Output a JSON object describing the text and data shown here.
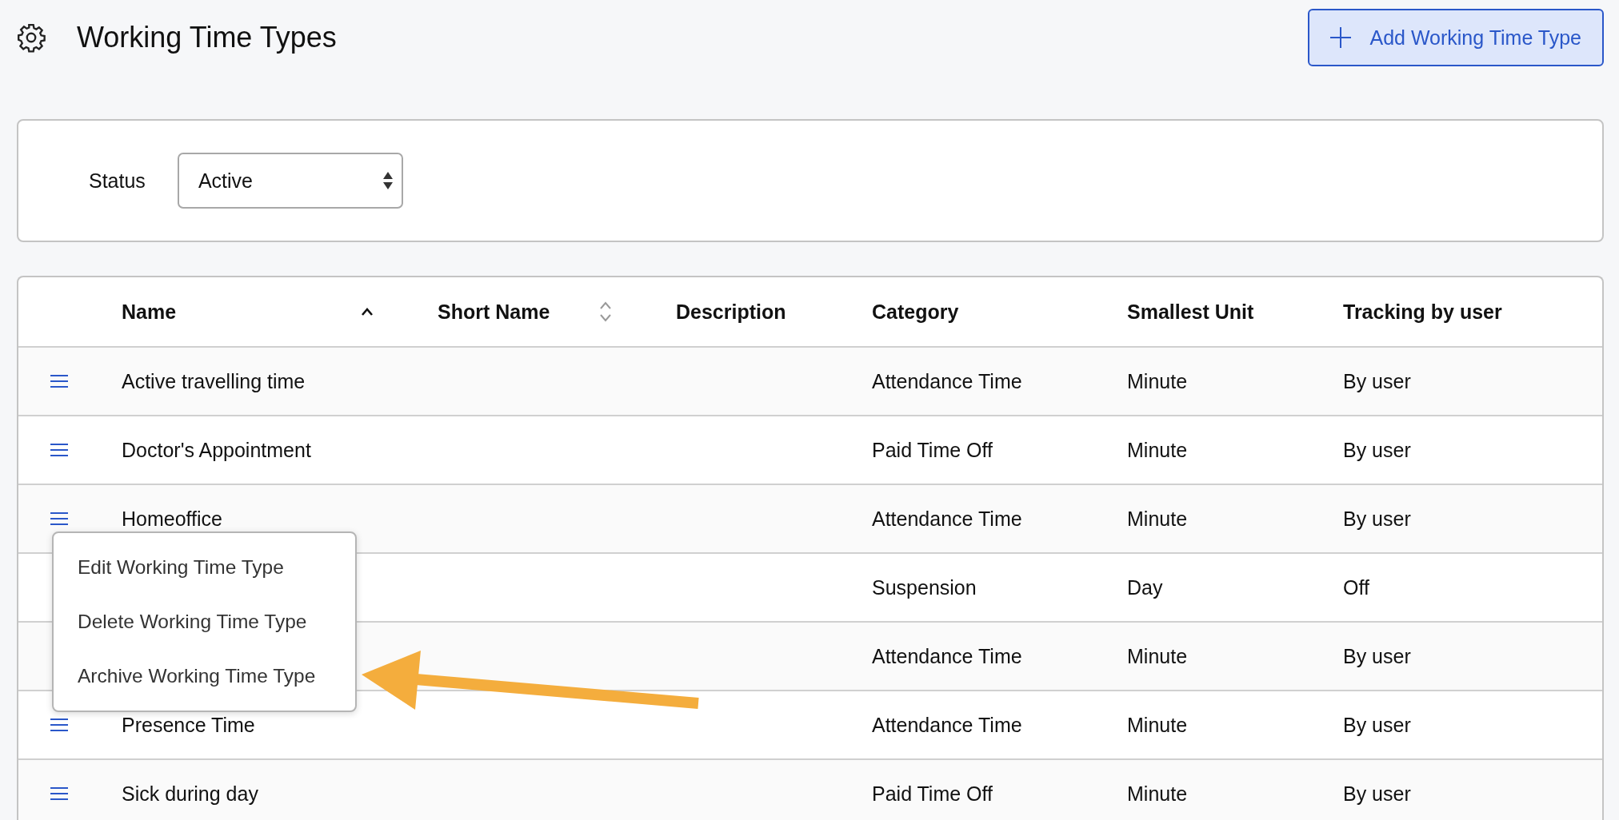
{
  "page": {
    "title": "Working Time Types",
    "add_button": "Add Working Time Type"
  },
  "filter": {
    "label": "Status",
    "value": "Active"
  },
  "table": {
    "columns": [
      {
        "label": "Name",
        "sortable": true,
        "sorted": true
      },
      {
        "label": "Short Name",
        "sortable": true,
        "sorted": false
      },
      {
        "label": "Description"
      },
      {
        "label": "Category"
      },
      {
        "label": "Smallest Unit"
      },
      {
        "label": "Tracking by user"
      }
    ],
    "rows": [
      {
        "name": "Active travelling time",
        "category": "Attendance Time",
        "unit": "Minute",
        "tracking": "By user"
      },
      {
        "name": "Doctor's Appointment",
        "category": "Paid Time Off",
        "unit": "Minute",
        "tracking": "By user"
      },
      {
        "name": "Homeoffice",
        "category": "Attendance Time",
        "unit": "Minute",
        "tracking": "By user",
        "menu": [
          "Edit Working Time Type",
          "Delete Working Time Type",
          "Archive Working Time Type"
        ]
      },
      {
        "category": "Suspension",
        "unit": "Day",
        "tracking": "Off"
      },
      {
        "category": "Attendance Time",
        "unit": "Minute",
        "tracking": "By user"
      },
      {
        "name": "Presence Time",
        "category": "Attendance Time",
        "unit": "Minute",
        "tracking": "By user"
      },
      {
        "name": "Sick during day",
        "category": "Paid Time Off",
        "unit": "Minute",
        "tracking": "By user"
      }
    ]
  }
}
